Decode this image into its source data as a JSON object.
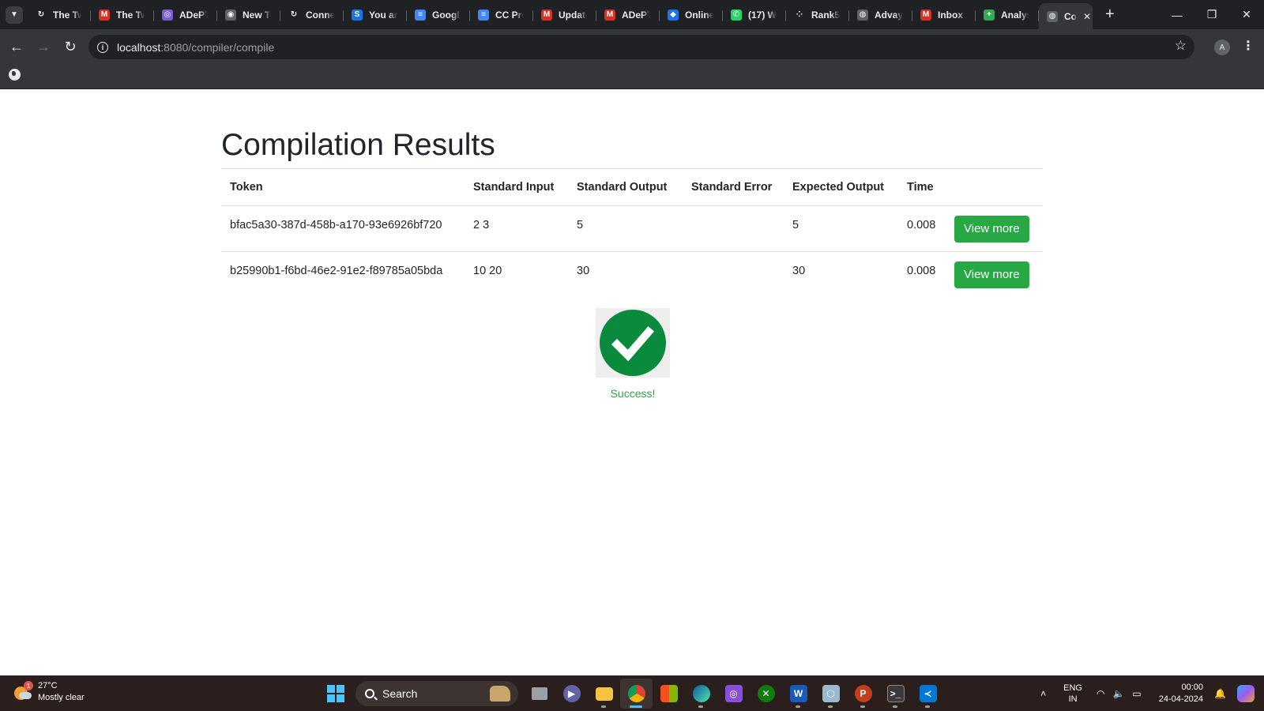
{
  "browser": {
    "tabs": [
      {
        "title": "The Tw",
        "icon": "refresh-circle-icon",
        "color": "#202124"
      },
      {
        "title": "The Tw",
        "icon": "gmail-icon",
        "color": "#d93025"
      },
      {
        "title": "ADePT",
        "icon": "circle-logo-icon",
        "color": "#7b5cd6"
      },
      {
        "title": "New Te",
        "icon": "chrome-icon",
        "color": "#5f6368"
      },
      {
        "title": "Conne",
        "icon": "refresh-circle-icon",
        "color": "#202124"
      },
      {
        "title": "You are",
        "icon": "s-logo-icon",
        "color": "#1a73e8"
      },
      {
        "title": "Google",
        "icon": "google-docs-icon",
        "color": "#4285f4"
      },
      {
        "title": "CC Pro",
        "icon": "google-docs-icon",
        "color": "#4285f4"
      },
      {
        "title": "Update",
        "icon": "gmail-icon",
        "color": "#d93025"
      },
      {
        "title": "ADePT",
        "icon": "gmail-icon",
        "color": "#d93025"
      },
      {
        "title": "Online",
        "icon": "compass-icon",
        "color": "#1a73e8"
      },
      {
        "title": "(17) W",
        "icon": "whatsapp-icon",
        "color": "#25d366"
      },
      {
        "title": "Rank5",
        "icon": "dots-icon",
        "color": "#202124"
      },
      {
        "title": "Advay",
        "icon": "globe-icon",
        "color": "#5f6368"
      },
      {
        "title": "Inbox (",
        "icon": "gmail-icon",
        "color": "#d93025"
      },
      {
        "title": "Analys",
        "icon": "google-sheets-icon",
        "color": "#34a853"
      }
    ],
    "active_tab": {
      "title": "Co",
      "icon": "globe-icon"
    },
    "url_host": "localhost",
    "url_rest": ":8080/compiler/compile",
    "profile_initial": "A"
  },
  "page": {
    "title": "Compilation Results",
    "columns": [
      "Token",
      "Standard Input",
      "Standard Output",
      "Standard Error",
      "Expected Output",
      "Time"
    ],
    "rows": [
      {
        "token": "bfac5a30-387d-458b-a170-93e6926bf720",
        "stdin": "2 3",
        "stdout": "5",
        "stderr": "",
        "expected": "5",
        "time": "0.008",
        "button": "View more"
      },
      {
        "token": "b25990b1-f6bd-46e2-91e2-f89785a05bda",
        "stdin": "10 20",
        "stdout": "30",
        "stderr": "",
        "expected": "30",
        "time": "0.008",
        "button": "View more"
      }
    ],
    "status_text": "Success!",
    "success_color": "#28a745"
  },
  "taskbar": {
    "weather_temp": "27°C",
    "weather_desc": "Mostly clear",
    "weather_badge": "1",
    "search_label": "Search",
    "lang_line1": "ENG",
    "lang_line2": "IN",
    "time": "00:00",
    "date": "24-04-2024"
  }
}
